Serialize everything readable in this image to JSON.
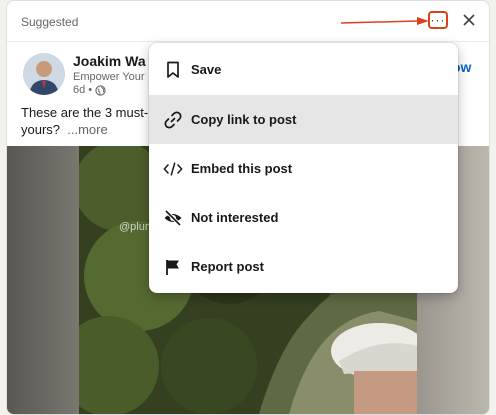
{
  "header": {
    "suggested_label": "Suggested",
    "more_icon": "ellipsis-icon",
    "close_icon": "close-icon",
    "annotation_color": "#d9431c"
  },
  "post": {
    "author_name": "Joakim Wa",
    "author_headline": "Empower Your",
    "age": "6d •",
    "visibility_icon": "globe-icon",
    "follow_label": "ow",
    "text_line1": "These are the 3 must-",
    "text_line2": "yours?",
    "more_label": "...more",
    "video_watermark": "@plum"
  },
  "menu": {
    "items": [
      {
        "label": "Save",
        "icon": "bookmark-icon"
      },
      {
        "label": "Copy link to post",
        "icon": "link-icon",
        "highlighted": true
      },
      {
        "label": "Embed this post",
        "icon": "code-icon"
      },
      {
        "label": "Not interested",
        "icon": "eye-slash-icon"
      },
      {
        "label": "Report post",
        "icon": "flag-icon"
      }
    ]
  },
  "colors": {
    "link_blue": "#0a66c2",
    "menu_hover": "#e6e6e6"
  }
}
